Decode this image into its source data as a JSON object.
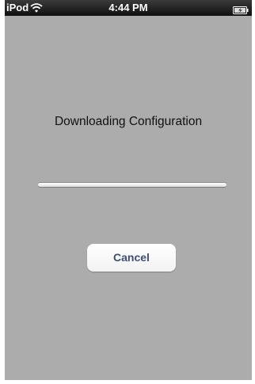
{
  "status_bar": {
    "carrier": "iPod",
    "time": "4:44 PM",
    "wifi_icon": "wifi-signal-icon",
    "battery_icon": "battery-charging-icon"
  },
  "dialog": {
    "message": "Downloading Configuration",
    "progress": 0.0,
    "cancel_label": "Cancel"
  },
  "colors": {
    "background": "#acacac",
    "button_text": "#3c4f78"
  }
}
